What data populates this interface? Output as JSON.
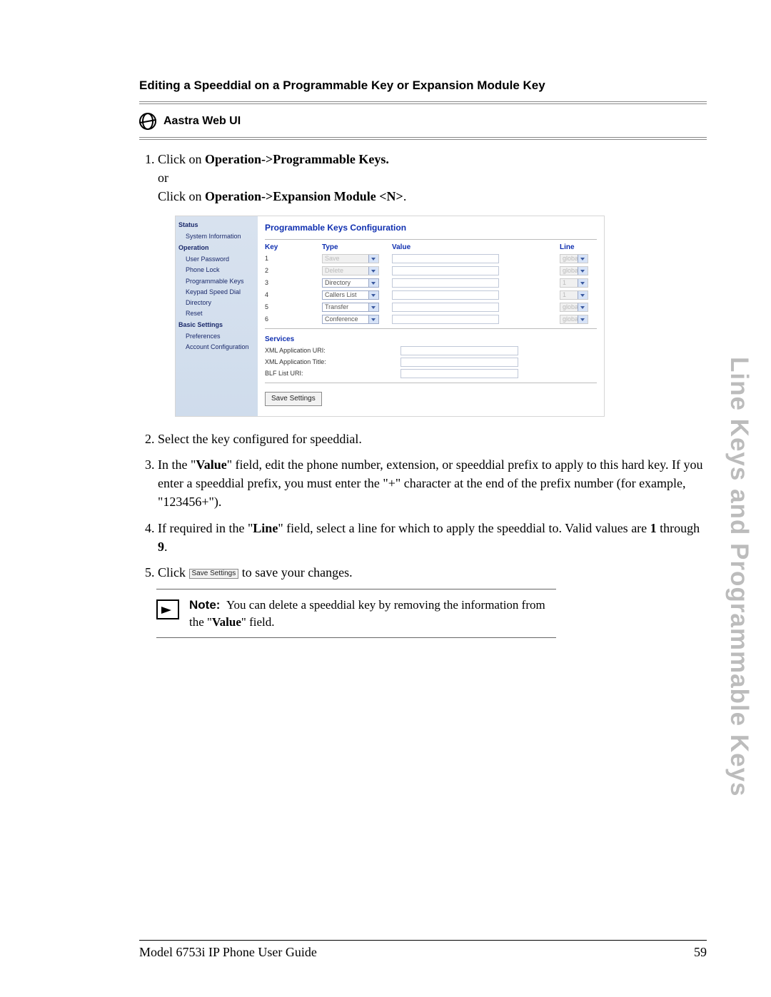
{
  "heading": "Editing a Speeddial on a Programmable Key or Expansion Module Key",
  "webui_label": "Aastra Web UI",
  "steps": {
    "s1a": "Click on ",
    "s1b": "Operation->Programmable Keys.",
    "s1or": "or",
    "s1c": "Click on ",
    "s1d": "Operation->Expansion Module <N>",
    "s1e": ".",
    "s2": "Select the key configured for speeddial.",
    "s3a": "In the \"",
    "s3b": "Value",
    "s3c": "\" field, edit the phone number, extension, or speeddial prefix to apply to this hard key. If you enter a speeddial prefix, you must enter the \"+\" character at the end of the prefix number (for example, \"123456+\").",
    "s4a": "If required in the \"",
    "s4b": "Line",
    "s4c": "\" field, select a line for which to apply the speeddial to. Valid values are ",
    "s4d": "1",
    "s4e": " through ",
    "s4f": "9",
    "s4g": ".",
    "s5a": "Click ",
    "s5b": " to save your changes."
  },
  "mini_save": "Save Settings",
  "note_label": "Note:",
  "note_text_a": "You can delete a speeddial key by removing the information from the \"",
  "note_text_b": "Value",
  "note_text_c": "\" field.",
  "side_title": "Line Keys and Programmable Keys",
  "footer_left": "Model 6753i IP Phone User Guide",
  "footer_right": "59",
  "shot": {
    "nav": {
      "status": "Status",
      "sysinfo": "System Information",
      "operation": "Operation",
      "userpw": "User Password",
      "phonelock": "Phone Lock",
      "progkeys": "Programmable Keys",
      "keypad": "Keypad Speed Dial",
      "directory": "Directory",
      "reset": "Reset",
      "basic": "Basic Settings",
      "prefs": "Preferences",
      "acct": "Account Configuration"
    },
    "title": "Programmable Keys Configuration",
    "cols": {
      "key": "Key",
      "type": "Type",
      "value": "Value",
      "line": "Line"
    },
    "rows": [
      {
        "key": "1",
        "type": "Save",
        "type_disabled": true,
        "line": "global",
        "line_disabled": true
      },
      {
        "key": "2",
        "type": "Delete",
        "type_disabled": true,
        "line": "global",
        "line_disabled": true
      },
      {
        "key": "3",
        "type": "Directory",
        "type_disabled": false,
        "line": "1",
        "line_disabled": true
      },
      {
        "key": "4",
        "type": "Callers List",
        "type_disabled": false,
        "line": "1",
        "line_disabled": true
      },
      {
        "key": "5",
        "type": "Transfer",
        "type_disabled": false,
        "line": "global",
        "line_disabled": true
      },
      {
        "key": "6",
        "type": "Conference",
        "type_disabled": false,
        "line": "global",
        "line_disabled": true
      }
    ],
    "services": "Services",
    "svc": {
      "xmlappuri": "XML Application URI:",
      "xmlapptitle": "XML Application Title:",
      "blflisturi": "BLF List URI:"
    },
    "save_btn": "Save Settings"
  }
}
